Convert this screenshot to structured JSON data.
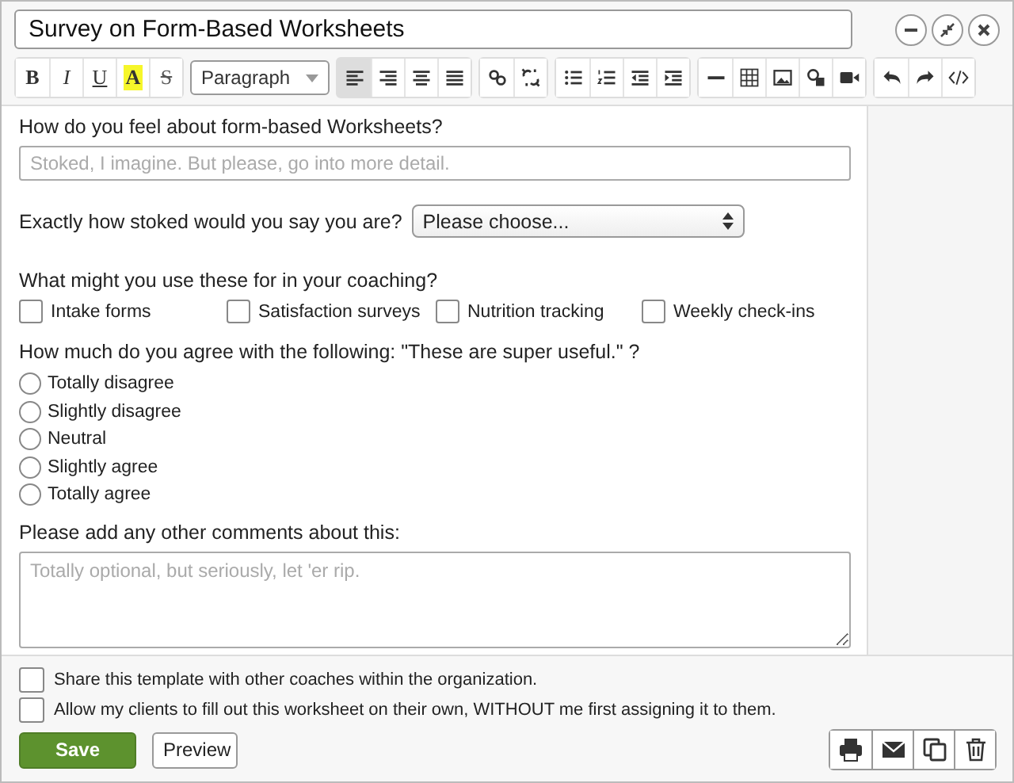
{
  "window": {
    "title": "Survey on Form-Based Worksheets"
  },
  "toolbar": {
    "format_buttons": [
      {
        "label": "B",
        "kind": "bold"
      },
      {
        "label": "I",
        "kind": "italic"
      },
      {
        "label": "U",
        "kind": "underline"
      },
      {
        "label": "A",
        "kind": "highlight"
      },
      {
        "label": "S",
        "kind": "strike"
      }
    ],
    "block_format": "Paragraph",
    "align_buttons": [
      {
        "selected": true
      },
      {
        "selected": false
      },
      {
        "selected": false
      },
      {
        "selected": false
      }
    ]
  },
  "questions": [
    {
      "kind": "text",
      "label": "How do you feel about form-based Worksheets?",
      "placeholder": "Stoked, I imagine. But please, go into more detail."
    },
    {
      "kind": "select",
      "label": "Exactly how stoked would you say you are?",
      "value": "Please choose..."
    },
    {
      "kind": "checkboxes",
      "label": "What might you use these for in your coaching?",
      "options": [
        {
          "label": "Intake forms",
          "checked": false
        },
        {
          "label": "Satisfaction surveys",
          "checked": false
        },
        {
          "label": "Nutrition tracking",
          "checked": false
        },
        {
          "label": "Weekly check-ins",
          "checked": false
        }
      ]
    },
    {
      "kind": "radios",
      "label": "How much do you agree with the following: \"These are super useful.\" ?",
      "options": [
        {
          "label": "Totally disagree",
          "selected": false
        },
        {
          "label": "Slightly disagree",
          "selected": false
        },
        {
          "label": "Neutral",
          "selected": false
        },
        {
          "label": "Slightly agree",
          "selected": false
        },
        {
          "label": "Totally agree",
          "selected": false
        }
      ]
    },
    {
      "kind": "textarea",
      "label": "Please add any other comments about this:",
      "placeholder": "Totally optional, but seriously, let 'er rip."
    }
  ],
  "settings": [
    {
      "label": "Share this template with other coaches within the organization.",
      "checked": false
    },
    {
      "label": "Allow my clients to fill out this worksheet on their own, WITHOUT me first assigning it to them.",
      "checked": false
    }
  ],
  "buttons": [
    {
      "kind": "primary",
      "label": "Save"
    },
    {
      "kind": "secondary",
      "label": "Preview"
    }
  ]
}
